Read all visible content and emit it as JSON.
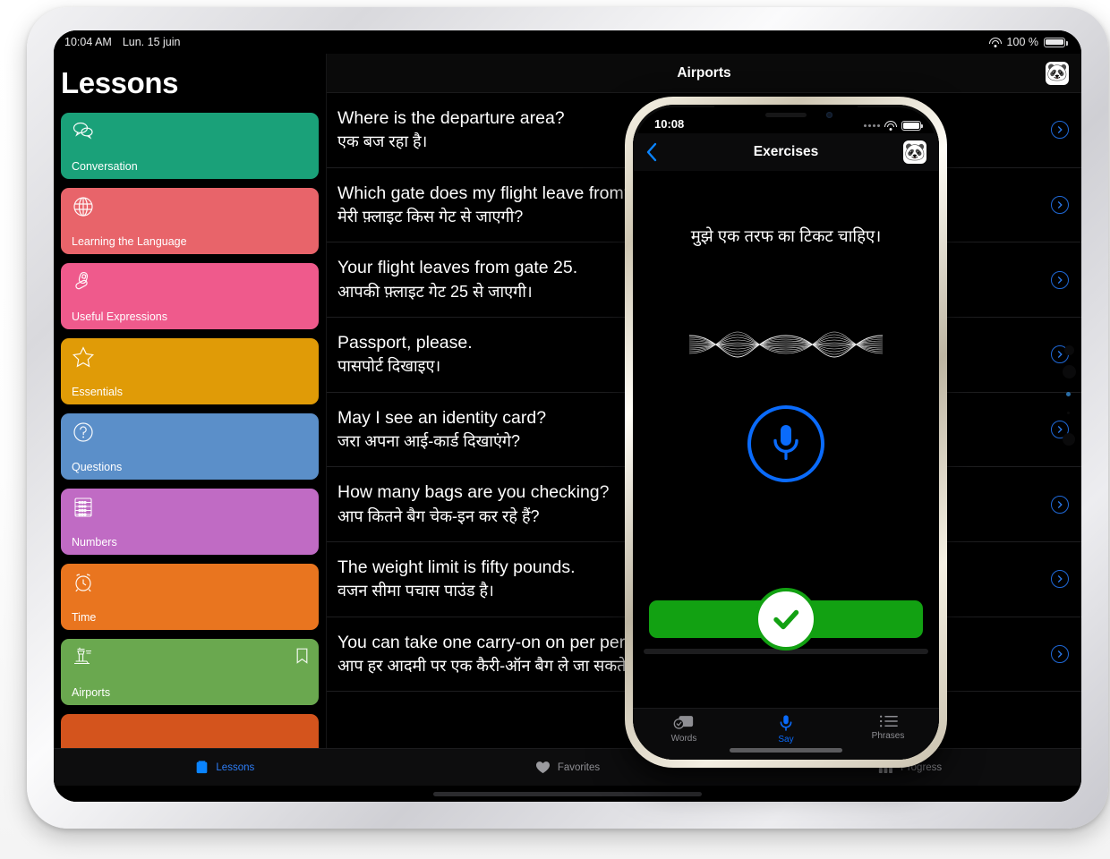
{
  "ipad": {
    "status_bar": {
      "time": "10:04 AM",
      "date": "Lun. 15 juin",
      "battery_percent": "100 %",
      "wifi_icon": "wifi-icon",
      "battery_icon": "battery-icon"
    },
    "sidebar": {
      "title": "Lessons",
      "items": [
        {
          "label": "Conversation",
          "icon": "speech-bubbles-icon",
          "color": "#1aa179",
          "bookmarked": false
        },
        {
          "label": "Learning the Language",
          "icon": "globe-icon",
          "color": "#e8646a",
          "bookmarked": false
        },
        {
          "label": "Useful Expressions",
          "icon": "swiss-knife-icon",
          "color": "#ef5a8c",
          "bookmarked": false
        },
        {
          "label": "Essentials",
          "icon": "star-icon",
          "color": "#e09b07",
          "bookmarked": false
        },
        {
          "label": "Questions",
          "icon": "question-mark-icon",
          "color": "#5b8fc9",
          "bookmarked": false
        },
        {
          "label": "Numbers",
          "icon": "abacus-icon",
          "color": "#c06bc4",
          "bookmarked": false
        },
        {
          "label": "Time",
          "icon": "alarm-clock-icon",
          "color": "#e9751f",
          "bookmarked": false
        },
        {
          "label": "Airports",
          "icon": "control-tower-icon",
          "color": "#6aa84f",
          "bookmarked": true
        },
        {
          "label": "",
          "icon": "",
          "color": "#d4541d",
          "bookmarked": false
        }
      ]
    },
    "detail": {
      "title": "Airports",
      "avatar_icon": "panda-avatar",
      "disclosure_icon": "chevron-right-circle-icon",
      "phrases": [
        {
          "en": "Where is the departure area?",
          "hi": "एक बज रहा है।"
        },
        {
          "en": "Which gate does my flight leave from?",
          "hi": "मेरी फ़्लाइट किस गेट से जाएगी?"
        },
        {
          "en": "Your flight leaves from gate 25.",
          "hi": "आपकी फ़्लाइट गेट 25 से जाएगी।"
        },
        {
          "en": "Passport, please.",
          "hi": "पासपोर्ट दिखाइए।"
        },
        {
          "en": "May I see an identity card?",
          "hi": "जरा अपना आई-कार्ड दिखाएंगे?"
        },
        {
          "en": "How many bags are you checking?",
          "hi": "आप कितने बैग चेक-इन कर रहे हैं?"
        },
        {
          "en": "The weight limit is fifty pounds.",
          "hi": "वजन सीमा पचास पाउंड है।"
        },
        {
          "en": "You can take one carry-on on per person.",
          "hi": "आप हर आदमी पर एक कैरी-ऑन बैग ले जा सकते हैं।"
        }
      ]
    },
    "tab_bar": [
      {
        "label": "Lessons",
        "icon": "book-icon",
        "active": true
      },
      {
        "label": "Favorites",
        "icon": "heart-icon",
        "active": false
      },
      {
        "label": "Progress",
        "icon": "bar-chart-icon",
        "active": false
      }
    ]
  },
  "iphone": {
    "status_bar": {
      "time": "10:08",
      "signal_icon": "signal-dots-icon",
      "wifi_icon": "wifi-icon",
      "battery_icon": "battery-icon"
    },
    "nav": {
      "back_icon": "chevron-left-icon",
      "title": "Exercises",
      "avatar_icon": "panda-avatar"
    },
    "exercise": {
      "phrase": "मुझे एक तरफ का टिकट चाहिए।",
      "waveform_icon": "audio-waveform-icon",
      "mic_icon": "microphone-icon",
      "check_icon": "checkmark-icon",
      "progress_color": "#12a112",
      "mic_color": "#0a6bfb"
    },
    "tab_bar": [
      {
        "label": "Words",
        "icon": "flashcard-check-icon",
        "active": false
      },
      {
        "label": "Say",
        "icon": "microphone-icon",
        "active": true
      },
      {
        "label": "Phrases",
        "icon": "list-icon",
        "active": false
      }
    ]
  }
}
